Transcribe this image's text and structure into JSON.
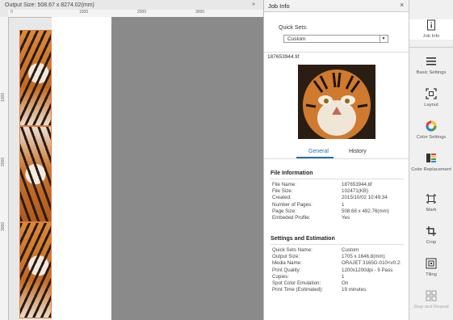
{
  "preview": {
    "output_size": "Output Size:  508.67 x 8274.02(mm)",
    "ruler_marks": [
      "0",
      "1000",
      "2000",
      "3000"
    ],
    "ruler_side_marks": [
      "1000",
      "2000",
      "3000"
    ],
    "collapse": "»"
  },
  "panel": {
    "title": "Job Info",
    "close": "×",
    "quick_sets_label": "Quick Sets:",
    "quick_sets_value": "Custom",
    "filename": "187653944.tif",
    "tabs": {
      "general": "General",
      "history": "History"
    },
    "file_info_title": "File Information",
    "file_info": [
      {
        "k": "File Name:",
        "v": "187653944.tif"
      },
      {
        "k": "File Size:",
        "v": "102471(KB)"
      },
      {
        "k": "Created:",
        "v": "2015/10/02 10:49:34"
      },
      {
        "k": "Number of Pages:",
        "v": "1"
      },
      {
        "k": "Page Size:",
        "v": "508.68 x 492.76(mm)"
      },
      {
        "k": "Embeded Profile:",
        "v": "Yes"
      }
    ],
    "settings_title": "Settings and Estimation",
    "settings": [
      {
        "k": "Quick Sets Name:",
        "v": "Custom"
      },
      {
        "k": "Output Size:",
        "v": "1705 x 1646.8(mm)"
      },
      {
        "k": "Media Name:",
        "v": "ORAJET 3165G-010<v0.2:"
      },
      {
        "k": "Print Quality:",
        "v": "1200x1200dpi - 9 Pass"
      },
      {
        "k": "Copies:",
        "v": "1"
      },
      {
        "k": "Spot Color Emulation:",
        "v": "On"
      },
      {
        "k": "Print Time (Estimated):",
        "v": "19 minutes"
      }
    ]
  },
  "toolbar": [
    {
      "label": "Job Info",
      "icon": "document-info-icon"
    },
    {
      "label": "Basic Settings",
      "icon": "list-icon"
    },
    {
      "label": "Layout",
      "icon": "layout-icon"
    },
    {
      "label": "Color Settings",
      "icon": "color-wheel-icon"
    },
    {
      "label": "Color Replacement",
      "icon": "color-replace-icon"
    },
    {
      "label": "Mark",
      "icon": "mark-icon"
    },
    {
      "label": "Crop",
      "icon": "crop-icon"
    },
    {
      "label": "Tiling",
      "icon": "tiling-icon"
    },
    {
      "label": "Step and Repeat",
      "icon": "step-repeat-icon"
    }
  ],
  "colors": {
    "accent": "#2b6cb0",
    "tile_border": "#e07a3a",
    "canvas": "#8a8a8a"
  }
}
